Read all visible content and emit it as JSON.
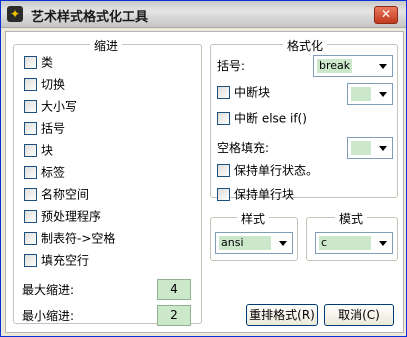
{
  "window": {
    "title": "艺术样式格式化工具",
    "icon": "app-icon",
    "close": "close-icon"
  },
  "indent": {
    "legend": "缩进",
    "checkboxes": [
      "类",
      "切换",
      "大小写",
      "括号",
      "块",
      "标签",
      "名称空间",
      "预处理程序",
      "制表符->空格",
      "填充空行"
    ],
    "max_label": "最大缩进:",
    "max_value": "4",
    "min_label": "最小缩进:",
    "min_value": "2"
  },
  "format": {
    "legend": "格式化",
    "bracket_label": "括号:",
    "bracket_value": "break",
    "break_block_label": "中断块",
    "break_block_value": "",
    "break_elseif_label": "中断 else if()",
    "space_pad_label": "空格填充:",
    "space_pad_value": "",
    "keep_oneline_statements": "保持单行状态。",
    "keep_oneline_blocks": "保持单行块"
  },
  "style": {
    "legend": "样式",
    "value": "ansi"
  },
  "mode": {
    "legend": "模式",
    "value": "c"
  },
  "buttons": {
    "reformat": "重排格式(R)",
    "cancel": "取消(C)"
  }
}
